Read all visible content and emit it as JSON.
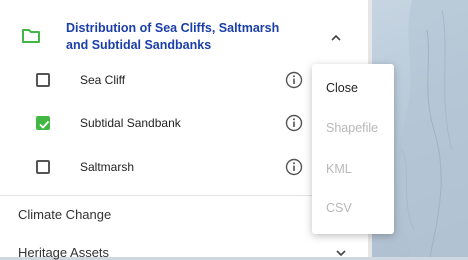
{
  "layers_panel": {
    "group": {
      "title": "Distribution of Sea Cliffs, Saltmarsh and Subtidal Sandbanks",
      "icon": "folder-icon",
      "accent_color": "#43b743",
      "title_color": "#1a3fa8"
    },
    "layers": [
      {
        "label": "Sea Cliff",
        "checked": false
      },
      {
        "label": "Subtidal Sandbank",
        "checked": true
      },
      {
        "label": "Saltmarsh",
        "checked": false
      }
    ],
    "sections": [
      {
        "label": "Climate Change"
      },
      {
        "label": "Heritage Assets"
      }
    ]
  },
  "download_menu": {
    "items": [
      {
        "label": "Close",
        "enabled": true
      },
      {
        "label": "Shapefile",
        "enabled": false
      },
      {
        "label": "KML",
        "enabled": false
      },
      {
        "label": "CSV",
        "enabled": false
      }
    ]
  }
}
